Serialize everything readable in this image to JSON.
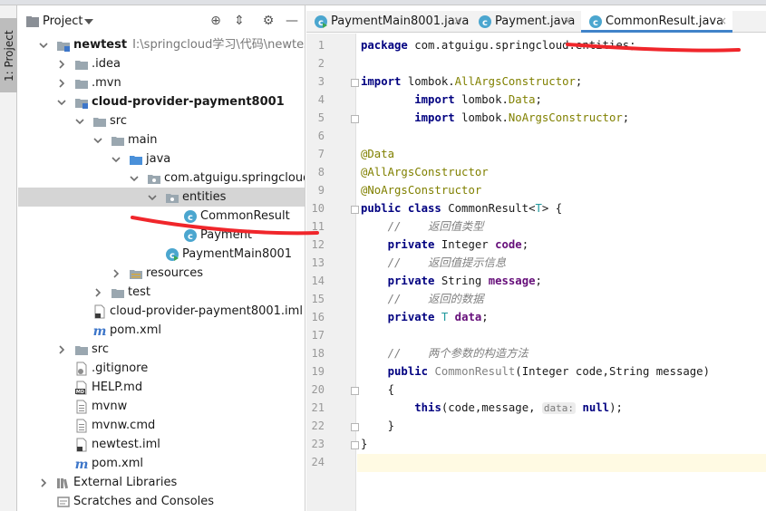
{
  "sidebar_strip": {
    "project_tab_label": "1: Project"
  },
  "project_panel": {
    "title": "Project",
    "tree": [
      {
        "label": "newtest",
        "path": "I:\\springcloud学习\\代码\\newtest",
        "icon": "module-folder-icon",
        "chevron": "down",
        "bold": true
      },
      {
        "label": ".idea",
        "icon": "folder-icon",
        "chevron": "right"
      },
      {
        "label": ".mvn",
        "icon": "folder-icon",
        "chevron": "right"
      },
      {
        "label": "cloud-provider-payment8001",
        "icon": "module-folder-icon",
        "chevron": "down",
        "bold": true
      },
      {
        "label": "src",
        "icon": "folder-icon",
        "chevron": "down"
      },
      {
        "label": "main",
        "icon": "folder-icon",
        "chevron": "down"
      },
      {
        "label": "java",
        "icon": "source-folder-icon",
        "chevron": "down"
      },
      {
        "label": "com.atguigu.springcloud",
        "icon": "package-icon",
        "chevron": "down"
      },
      {
        "label": "entities",
        "icon": "package-icon",
        "chevron": "down",
        "selected": true
      },
      {
        "label": "CommonResult",
        "icon": "class-icon"
      },
      {
        "label": "Payment",
        "icon": "class-icon"
      },
      {
        "label": "PaymentMain8001",
        "icon": "runnable-class-icon"
      },
      {
        "label": "resources",
        "icon": "resources-folder-icon",
        "chevron": "right"
      },
      {
        "label": "test",
        "icon": "folder-icon",
        "chevron": "right"
      },
      {
        "label": "cloud-provider-payment8001.iml",
        "icon": "iml-file-icon"
      },
      {
        "label": "pom.xml",
        "icon": "maven-file-icon"
      },
      {
        "label": "src",
        "icon": "folder-icon",
        "chevron": "right"
      },
      {
        "label": ".gitignore",
        "icon": "gitignore-file-icon"
      },
      {
        "label": "HELP.md",
        "icon": "markdown-file-icon"
      },
      {
        "label": "mvnw",
        "icon": "text-file-icon"
      },
      {
        "label": "mvnw.cmd",
        "icon": "text-file-icon"
      },
      {
        "label": "newtest.iml",
        "icon": "iml-file-icon"
      },
      {
        "label": "pom.xml",
        "icon": "maven-file-icon"
      },
      {
        "label": "External Libraries",
        "icon": "library-icon",
        "chevron": "right"
      },
      {
        "label": "Scratches and Consoles",
        "icon": "scratches-icon"
      }
    ]
  },
  "editor": {
    "tabs": [
      {
        "label": "PaymentMain8001.java",
        "icon": "runnable-class-icon",
        "active": false
      },
      {
        "label": "Payment.java",
        "icon": "class-icon",
        "active": false
      },
      {
        "label": "CommonResult.java",
        "icon": "class-icon",
        "active": true
      }
    ],
    "code_lines": [
      [
        [
          "kw",
          "package "
        ],
        [
          "",
          "com.atguigu.springcloud.entities;"
        ]
      ],
      [],
      [
        [
          "kw",
          "import "
        ],
        [
          "",
          "lombok."
        ],
        [
          "an",
          "AllArgsConstructor"
        ],
        [
          "",
          ";"
        ]
      ],
      [
        [
          "",
          "        "
        ],
        [
          "kw",
          "import "
        ],
        [
          "",
          "lombok."
        ],
        [
          "an",
          "Data"
        ],
        [
          "",
          ";"
        ]
      ],
      [
        [
          "",
          "        "
        ],
        [
          "kw",
          "import "
        ],
        [
          "",
          "lombok."
        ],
        [
          "an",
          "NoArgsConstructor"
        ],
        [
          "",
          ";"
        ]
      ],
      [],
      [
        [
          "an",
          "@Data"
        ]
      ],
      [
        [
          "an",
          "@AllArgsConstructor"
        ]
      ],
      [
        [
          "an",
          "@NoArgsConstructor"
        ]
      ],
      [
        [
          "kw",
          "public class "
        ],
        [
          "",
          "CommonResult<"
        ],
        [
          "tp",
          "T"
        ],
        [
          "",
          "> {"
        ]
      ],
      [
        [
          "",
          "    "
        ],
        [
          "cm",
          "//    返回值类型"
        ]
      ],
      [
        [
          "",
          "    "
        ],
        [
          "kw",
          "private "
        ],
        [
          "",
          "Integer "
        ],
        [
          "fd",
          "code"
        ],
        [
          "",
          ";"
        ]
      ],
      [
        [
          "",
          "    "
        ],
        [
          "cm",
          "//    返回值提示信息"
        ]
      ],
      [
        [
          "",
          "    "
        ],
        [
          "kw",
          "private "
        ],
        [
          "",
          "String "
        ],
        [
          "fd",
          "message"
        ],
        [
          "",
          ";"
        ]
      ],
      [
        [
          "",
          "    "
        ],
        [
          "cm",
          "//    返回的数据"
        ]
      ],
      [
        [
          "",
          "    "
        ],
        [
          "kw",
          "private "
        ],
        [
          "tp",
          "T "
        ],
        [
          "fd",
          "data"
        ],
        [
          "",
          ";"
        ]
      ],
      [],
      [
        [
          "",
          "    "
        ],
        [
          "cm",
          "//    两个参数的构造方法"
        ]
      ],
      [
        [
          "",
          "    "
        ],
        [
          "kw",
          "public "
        ],
        [
          "gr",
          "CommonResult"
        ],
        [
          "",
          "(Integer code,String message)"
        ]
      ],
      [
        [
          "",
          "    {"
        ]
      ],
      [
        [
          "",
          "        "
        ],
        [
          "kw",
          "this"
        ],
        [
          "",
          "(code,message, "
        ],
        [
          "hint",
          "data:"
        ],
        [
          "",
          " "
        ],
        [
          "kw",
          "null"
        ],
        [
          "",
          ");"
        ]
      ],
      [
        [
          "",
          "    }"
        ]
      ],
      [
        [
          "",
          "}"
        ]
      ],
      []
    ],
    "caret_line": 24
  },
  "annotations": {
    "underline_color": "#f0262b"
  }
}
